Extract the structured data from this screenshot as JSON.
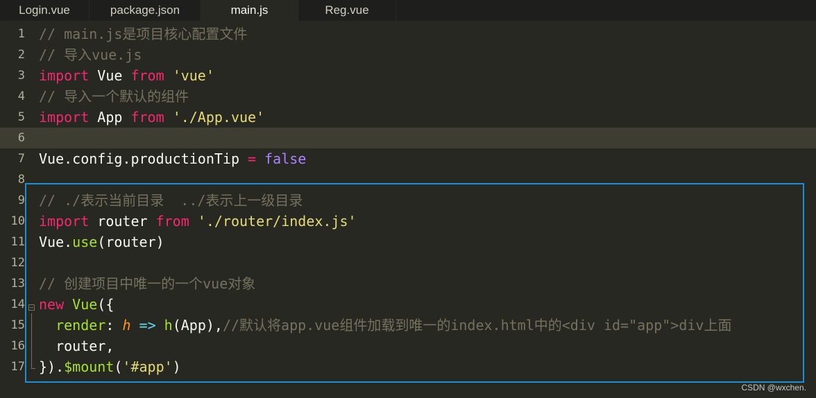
{
  "tabs": [
    {
      "label": "Login.vue",
      "active": false
    },
    {
      "label": "package.json",
      "active": false
    },
    {
      "label": "main.js",
      "active": true
    },
    {
      "label": "Reg.vue",
      "active": false
    }
  ],
  "lines": [
    {
      "num": "1",
      "tokens": [
        {
          "t": "// main.js是项目核心配置文件",
          "c": "cm"
        }
      ]
    },
    {
      "num": "2",
      "tokens": [
        {
          "t": "// 导入vue.js",
          "c": "cm"
        }
      ]
    },
    {
      "num": "3",
      "tokens": [
        {
          "t": "import",
          "c": "kw"
        },
        {
          "t": " Vue ",
          "c": "plain"
        },
        {
          "t": "from",
          "c": "kw"
        },
        {
          "t": " ",
          "c": "plain"
        },
        {
          "t": "'vue'",
          "c": "st"
        }
      ]
    },
    {
      "num": "4",
      "tokens": [
        {
          "t": "// 导入一个默认的组件",
          "c": "cm"
        }
      ]
    },
    {
      "num": "5",
      "tokens": [
        {
          "t": "import",
          "c": "kw"
        },
        {
          "t": " App ",
          "c": "plain"
        },
        {
          "t": "from",
          "c": "kw"
        },
        {
          "t": " ",
          "c": "plain"
        },
        {
          "t": "'./App.vue'",
          "c": "st"
        }
      ]
    },
    {
      "num": "6",
      "current": true,
      "tokens": []
    },
    {
      "num": "7",
      "tokens": [
        {
          "t": "Vue.config.productionTip ",
          "c": "plain"
        },
        {
          "t": "=",
          "c": "op"
        },
        {
          "t": " ",
          "c": "plain"
        },
        {
          "t": "false",
          "c": "cs"
        }
      ]
    },
    {
      "num": "8",
      "tokens": []
    },
    {
      "num": "9",
      "tokens": [
        {
          "t": "// ./表示当前目录  ../表示上一级目录",
          "c": "cm"
        }
      ]
    },
    {
      "num": "10",
      "tokens": [
        {
          "t": "import",
          "c": "kw"
        },
        {
          "t": " router ",
          "c": "plain"
        },
        {
          "t": "from",
          "c": "kw"
        },
        {
          "t": " ",
          "c": "plain"
        },
        {
          "t": "'./router/index.js'",
          "c": "st"
        }
      ]
    },
    {
      "num": "11",
      "tokens": [
        {
          "t": "Vue.",
          "c": "plain"
        },
        {
          "t": "use",
          "c": "fn"
        },
        {
          "t": "(router)",
          "c": "plain"
        }
      ]
    },
    {
      "num": "12",
      "tokens": []
    },
    {
      "num": "13",
      "tokens": [
        {
          "t": "// 创建项目中唯一的一个vue对象",
          "c": "cm"
        }
      ]
    },
    {
      "num": "14",
      "tokens": [
        {
          "t": "new",
          "c": "kw"
        },
        {
          "t": " ",
          "c": "plain"
        },
        {
          "t": "Vue",
          "c": "fn"
        },
        {
          "t": "({",
          "c": "plain"
        }
      ]
    },
    {
      "num": "15",
      "tokens": [
        {
          "t": "  ",
          "c": "plain"
        },
        {
          "t": "render",
          "c": "fn"
        },
        {
          "t": ": ",
          "c": "plain"
        },
        {
          "t": "h",
          "c": "pa"
        },
        {
          "t": " ",
          "c": "plain"
        },
        {
          "t": "=>",
          "c": "ty"
        },
        {
          "t": " ",
          "c": "plain"
        },
        {
          "t": "h",
          "c": "fn"
        },
        {
          "t": "(App),",
          "c": "plain"
        },
        {
          "t": "//默认将app.vue组件加载到唯一的index.html中的<div id=\"app\">div上面",
          "c": "cm"
        }
      ]
    },
    {
      "num": "16",
      "tokens": [
        {
          "t": "  router,",
          "c": "plain"
        }
      ]
    },
    {
      "num": "17",
      "tokens": [
        {
          "t": "}).",
          "c": "plain"
        },
        {
          "t": "$mount",
          "c": "fn"
        },
        {
          "t": "(",
          "c": "plain"
        },
        {
          "t": "'#app'",
          "c": "st"
        },
        {
          "t": ")",
          "c": "plain"
        }
      ]
    }
  ],
  "watermark": "CSDN @wxchen."
}
